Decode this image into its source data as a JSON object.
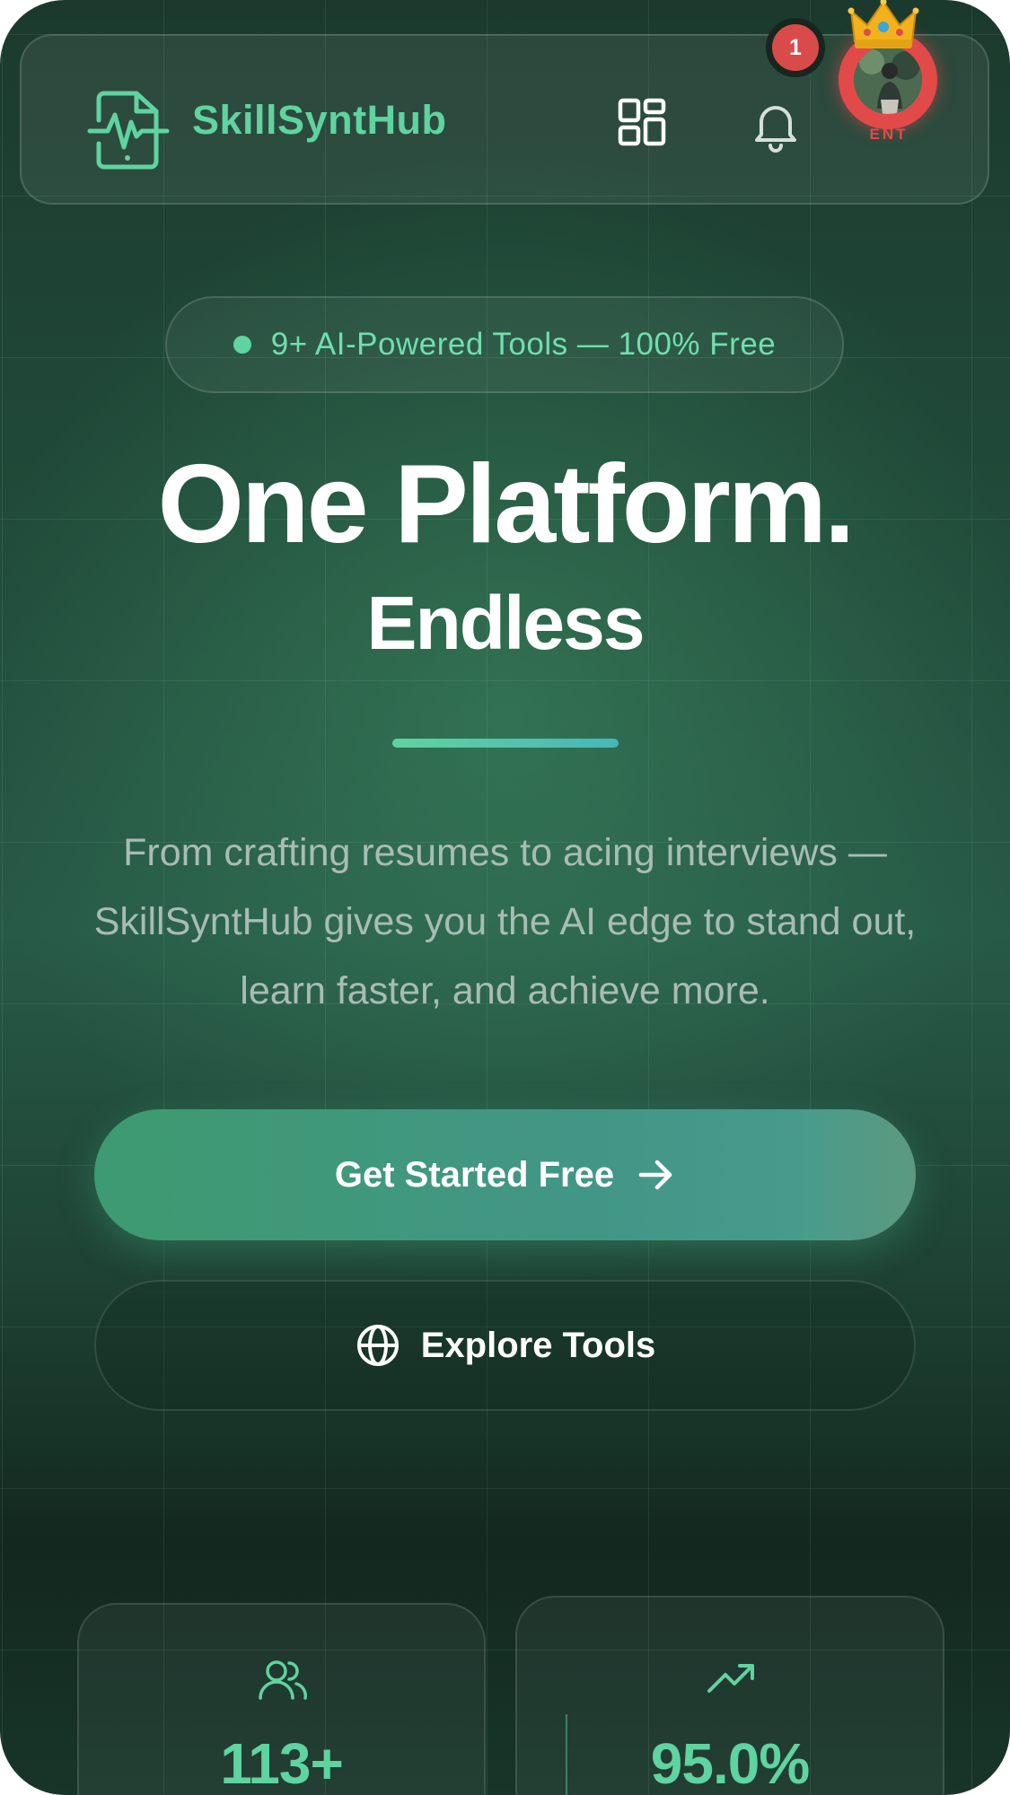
{
  "header": {
    "brand": "SkillSyntHub",
    "icons": {
      "logo": "phone-pulse-icon",
      "apps": "grid-icon",
      "notifications": "bell-icon",
      "crown": "crown-icon"
    },
    "notification_count": "1",
    "user_tier": "ENT"
  },
  "badge": {
    "text": "9+ AI-Powered Tools — 100% Free"
  },
  "hero": {
    "title": "One Platform.",
    "subtitle": "Endless",
    "description": "From crafting resumes to acing interviews — SkillSyntHub gives you the AI edge to stand out, learn faster, and achieve more."
  },
  "actions": {
    "primary_label": "Get Started Free",
    "primary_icon": "arrow-right-icon",
    "secondary_label": "Explore Tools",
    "secondary_icon": "globe-icon"
  },
  "stats": [
    {
      "icon": "users-icon",
      "value": "113+"
    },
    {
      "icon": "trending-up-icon",
      "value": "95.0%"
    }
  ],
  "colors": {
    "accent": "#5fd3a0",
    "badge_red": "#d94a4a",
    "text": "#ffffff",
    "muted_text": "#a9bcb4"
  }
}
